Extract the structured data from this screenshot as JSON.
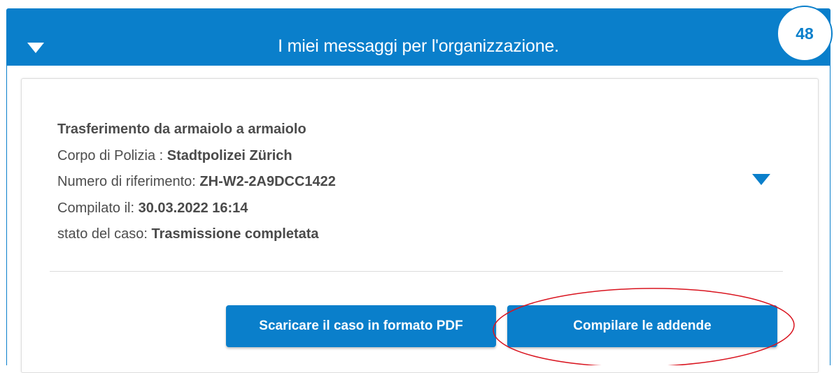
{
  "panel": {
    "title": "I miei messaggi per l'organizzazione.",
    "message_count": "48",
    "toggle_icon": "caret-down-icon"
  },
  "case": {
    "type_title": "Trasferimento da armaiolo a armaiolo",
    "police_label": "Corpo di Polizia : ",
    "police_value": "Stadtpolizei Zürich",
    "reference_label": "Numero di riferimento: ",
    "reference_value": "ZH-W2-2A9DCC1422",
    "compiled_label": "Compilato il: ",
    "compiled_value": "30.03.2022 16:14",
    "status_label": "stato del caso: ",
    "status_value": "Trasmissione completata",
    "expand_icon": "caret-down-icon"
  },
  "actions": {
    "download_pdf_label": "Scaricare il caso in formato PDF",
    "fill_addenda_label": "Compilare le addende"
  },
  "colors": {
    "brand_blue": "#0a7fcb",
    "annotation_red": "#d9141f"
  }
}
